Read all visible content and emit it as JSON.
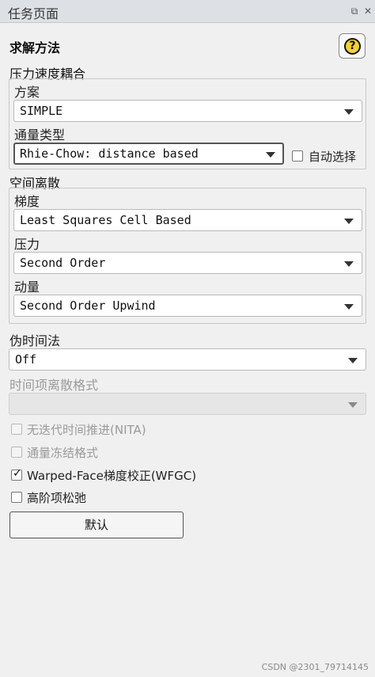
{
  "panel": {
    "title": "任务页面",
    "section_title": "求解方法"
  },
  "pv_coupling": {
    "title": "压力速度耦合",
    "scheme_label": "方案",
    "scheme_value": "SIMPLE",
    "flux_label": "通量类型",
    "flux_value": "Rhie-Chow: distance based",
    "auto_select_label": "自动选择",
    "auto_select_checked": false
  },
  "spatial": {
    "title": "空间离散",
    "gradient_label": "梯度",
    "gradient_value": "Least Squares Cell Based",
    "pressure_label": "压力",
    "pressure_value": "Second Order",
    "momentum_label": "动量",
    "momentum_value": "Second Order Upwind"
  },
  "pseudo_time": {
    "label": "伪时间法",
    "value": "Off"
  },
  "transient": {
    "label": "时间项离散格式",
    "value": ""
  },
  "options": {
    "nita_label": "无迭代时间推进(NITA)",
    "frozen_flux_label": "通量冻结格式",
    "wfgc_label": "Warped-Face梯度校正(WFGC)",
    "high_order_label": "高阶项松弛"
  },
  "default_button": "默认",
  "watermark": "CSDN @2301_79714145",
  "colors": {
    "help_icon_fill": "#f2d03b",
    "panel_bg": "#f0f0f0"
  }
}
